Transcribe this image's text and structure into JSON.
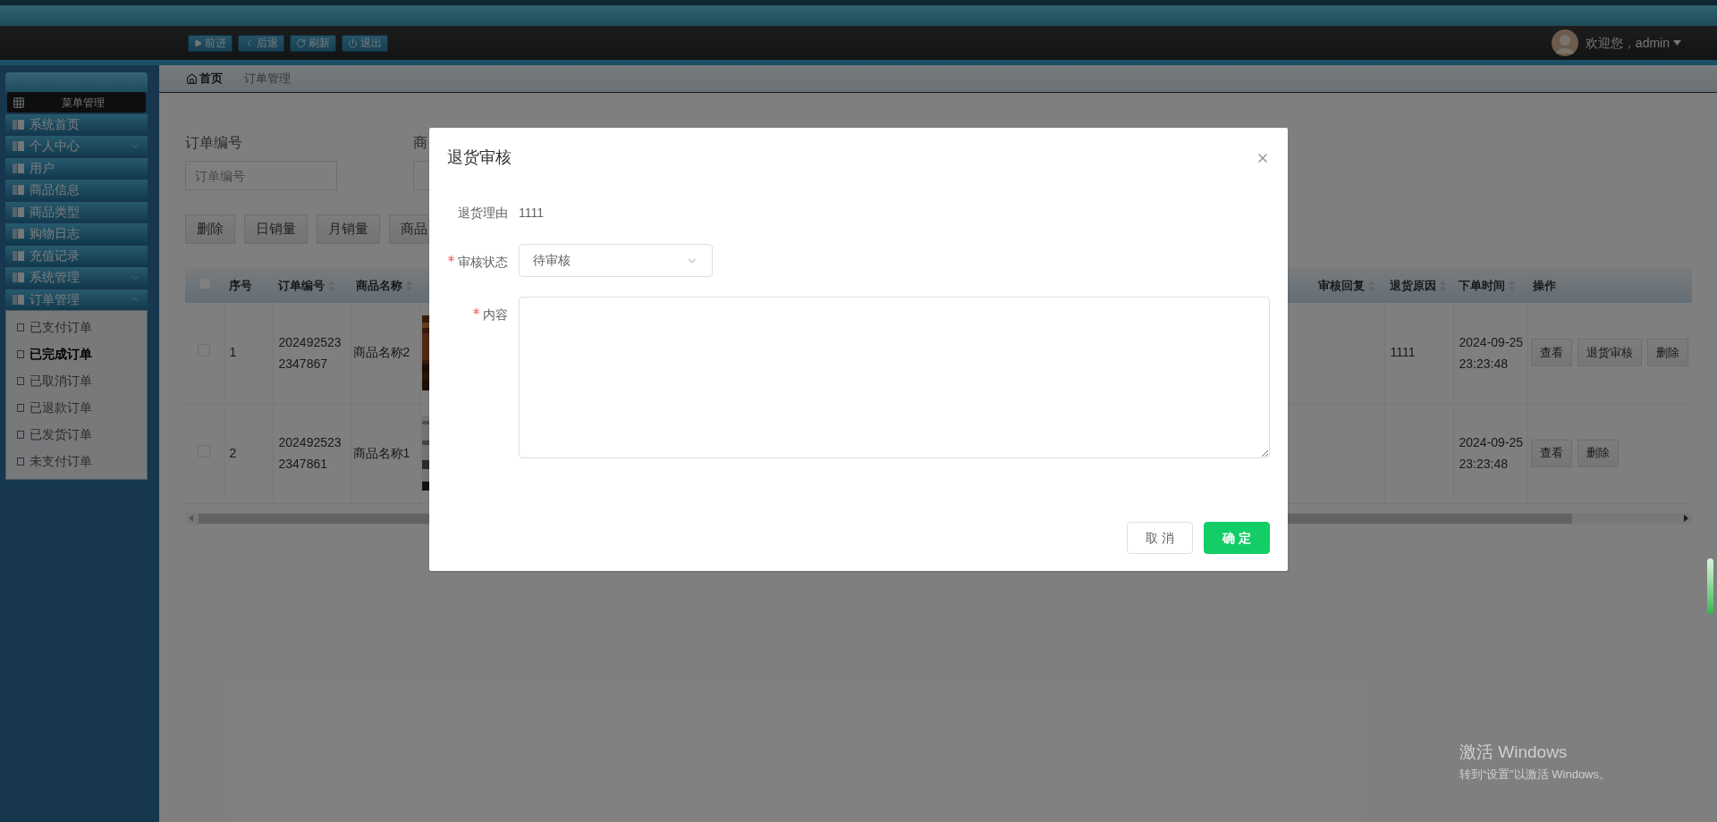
{
  "top_bar": {
    "nav_buttons": [
      {
        "kind": "forward",
        "label": "前进"
      },
      {
        "kind": "back",
        "label": "后退"
      },
      {
        "kind": "refresh",
        "label": "刷新"
      },
      {
        "kind": "logout",
        "label": "退出"
      }
    ],
    "user_menu": "欢迎您，admin"
  },
  "sidebar": {
    "title": "菜单管理",
    "items": [
      {
        "kind": "link",
        "label": "系统首页"
      },
      {
        "kind": "group",
        "label": "个人中心",
        "expanded": false
      },
      {
        "kind": "link",
        "label": "用户"
      },
      {
        "kind": "link",
        "label": "商品信息"
      },
      {
        "kind": "link",
        "label": "商品类型"
      },
      {
        "kind": "link",
        "label": "购物日志"
      },
      {
        "kind": "link",
        "label": "充值记录"
      },
      {
        "kind": "group",
        "label": "系统管理",
        "expanded": false
      },
      {
        "kind": "group",
        "label": "订单管理",
        "expanded": true,
        "children": [
          {
            "label": "已支付订单",
            "selected": false
          },
          {
            "label": "已完成订单",
            "selected": true
          },
          {
            "label": "已取消订单",
            "selected": false
          },
          {
            "label": "已退款订单",
            "selected": false
          },
          {
            "label": "已发货订单",
            "selected": false
          },
          {
            "label": "未支付订单",
            "selected": false
          }
        ]
      }
    ]
  },
  "breadcrumb": [
    {
      "kind": "home",
      "label": "首页"
    },
    {
      "kind": "current",
      "label": "订单管理"
    }
  ],
  "filters": [
    {
      "label": "订单编号",
      "placeholder": "订单编号"
    },
    {
      "label": "商"
    }
  ],
  "toolbar_buttons": [
    "删除",
    "日销量",
    "月销量",
    "商品"
  ],
  "table": {
    "select_all": {
      "checked": false
    },
    "columns": [
      {
        "label": "序号",
        "sortable": false
      },
      {
        "label": "订单编号",
        "sortable": true
      },
      {
        "label": "商品名称",
        "sortable": true
      },
      {
        "label": "审核回复",
        "sortable": true
      },
      {
        "label": "退货原因",
        "sortable": true
      },
      {
        "label": "下单时间",
        "sortable": true
      },
      {
        "label": "操作",
        "sortable": false
      }
    ],
    "rows": [
      {
        "checked": false,
        "index": "1",
        "order_no": "2024925232347867",
        "product": "商品名称2",
        "reason": "1111",
        "time": "2024-09-25 23:23:48",
        "actions": [
          "查看",
          "退货审核",
          "删除"
        ]
      },
      {
        "checked": false,
        "index": "2",
        "order_no": "2024925232347861",
        "product": "商品名称1",
        "time": "2024-09-25 23:23:48",
        "actions": [
          "查看",
          "删除"
        ]
      }
    ]
  },
  "dialog": {
    "title": "退货审核",
    "fields": [
      {
        "kind": "readonly",
        "label": "退货理由",
        "value": "1111",
        "required": false
      },
      {
        "kind": "select",
        "label": "审核状态",
        "value": "待审核",
        "required": true
      },
      {
        "kind": "textarea",
        "label": "内容",
        "required": true
      }
    ],
    "buttons": [
      {
        "kind": "default",
        "label": "取 消"
      },
      {
        "kind": "primary",
        "label": "确 定"
      }
    ]
  },
  "activation_notice": {
    "title": "激活 Windows",
    "subtitle": "转到“设置”以激活 Windows。"
  }
}
